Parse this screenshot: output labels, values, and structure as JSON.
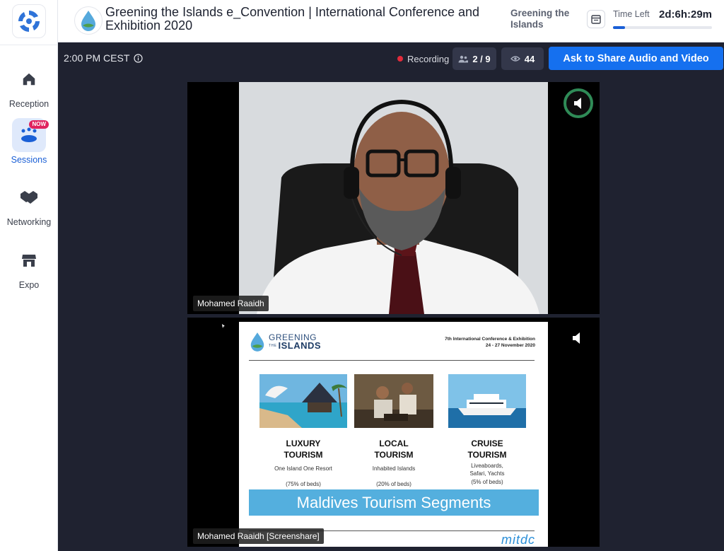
{
  "sidebar": {
    "items": [
      {
        "label": "Reception",
        "icon": "home-icon"
      },
      {
        "label": "Sessions",
        "icon": "sessions-icon",
        "badge": "NOW",
        "active": true
      },
      {
        "label": "Networking",
        "icon": "handshake-icon"
      },
      {
        "label": "Expo",
        "icon": "store-icon"
      }
    ]
  },
  "header": {
    "event_title": "Greening the Islands e_Convention | International Conference and Exhibition 2020",
    "organizer": "Greening the Islands",
    "time_left_label": "Time Left",
    "time_left_value": "2d:6h:29m",
    "time_left_progress": 0.12
  },
  "session_bar": {
    "time": "2:00 PM CEST",
    "recording_label": "Recording",
    "participants": "2 / 9",
    "viewers": "44",
    "ask_button": "Ask to Share Audio and Video"
  },
  "tiles": [
    {
      "name": "Mohamed Raaidh"
    },
    {
      "name": "Mohamed Raaidh [Screenshare]"
    }
  ],
  "slide": {
    "logo_top": "GREENING",
    "logo_the": "THE",
    "logo_bottom": "ISLANDS",
    "conference_line1": "7th International Conference & Exhibition",
    "conference_line2": "24 - 27 November 2020",
    "segments": [
      {
        "head1": "LUXURY",
        "head2": "TOURISM",
        "sub": "One Island One Resort",
        "pct": "(75% of beds)"
      },
      {
        "head1": "LOCAL",
        "head2": "TOURISM",
        "sub": "Inhabited Islands",
        "pct": "(20% of beds)"
      },
      {
        "head1": "CRUISE",
        "head2": "TOURISM",
        "sub": "Liveaboards, Safari, Yachts",
        "pct": "(5% of beds)"
      }
    ],
    "banner": "Maldives Tourism Segments",
    "footer_logo": "mitdc"
  },
  "colors": {
    "accent": "#1570ef",
    "recording": "#e22b3b",
    "speaking": "#2f8b57",
    "banner": "#54afde"
  }
}
